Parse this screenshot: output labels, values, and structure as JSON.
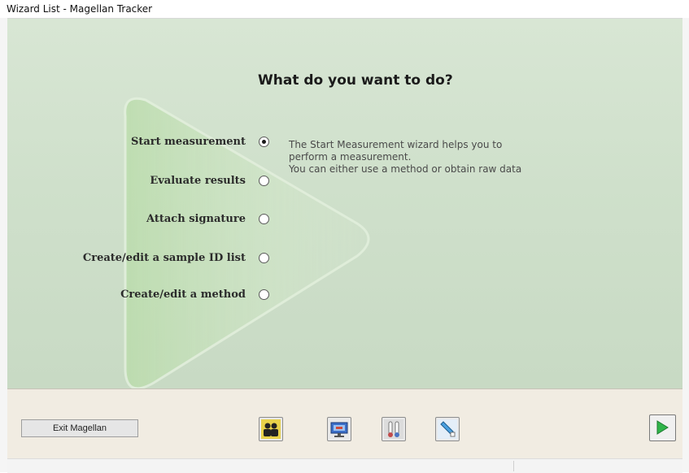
{
  "window": {
    "title": "Wizard List - Magellan Tracker"
  },
  "main": {
    "heading": "What do you want to do?",
    "options": [
      {
        "label": "Start measurement",
        "selected": true
      },
      {
        "label": "Evaluate results",
        "selected": false
      },
      {
        "label": "Attach signature",
        "selected": false
      },
      {
        "label": "Create/edit a sample ID list",
        "selected": false
      },
      {
        "label": "Create/edit a method",
        "selected": false
      }
    ],
    "description": [
      "The Start Measurement wizard helps you to",
      "perform a measurement.",
      "You can either use a method or obtain raw data"
    ]
  },
  "footer": {
    "exit_label": "Exit Magellan",
    "tools": [
      "users-icon",
      "display-icon",
      "thermometer-icon",
      "pipette-icon"
    ],
    "next_icon": "play-arrow-icon"
  },
  "colors": {
    "content_bg": "#cfe0cb",
    "bottom_bg": "#f1ece2",
    "next_arrow": "#2fb44a"
  }
}
